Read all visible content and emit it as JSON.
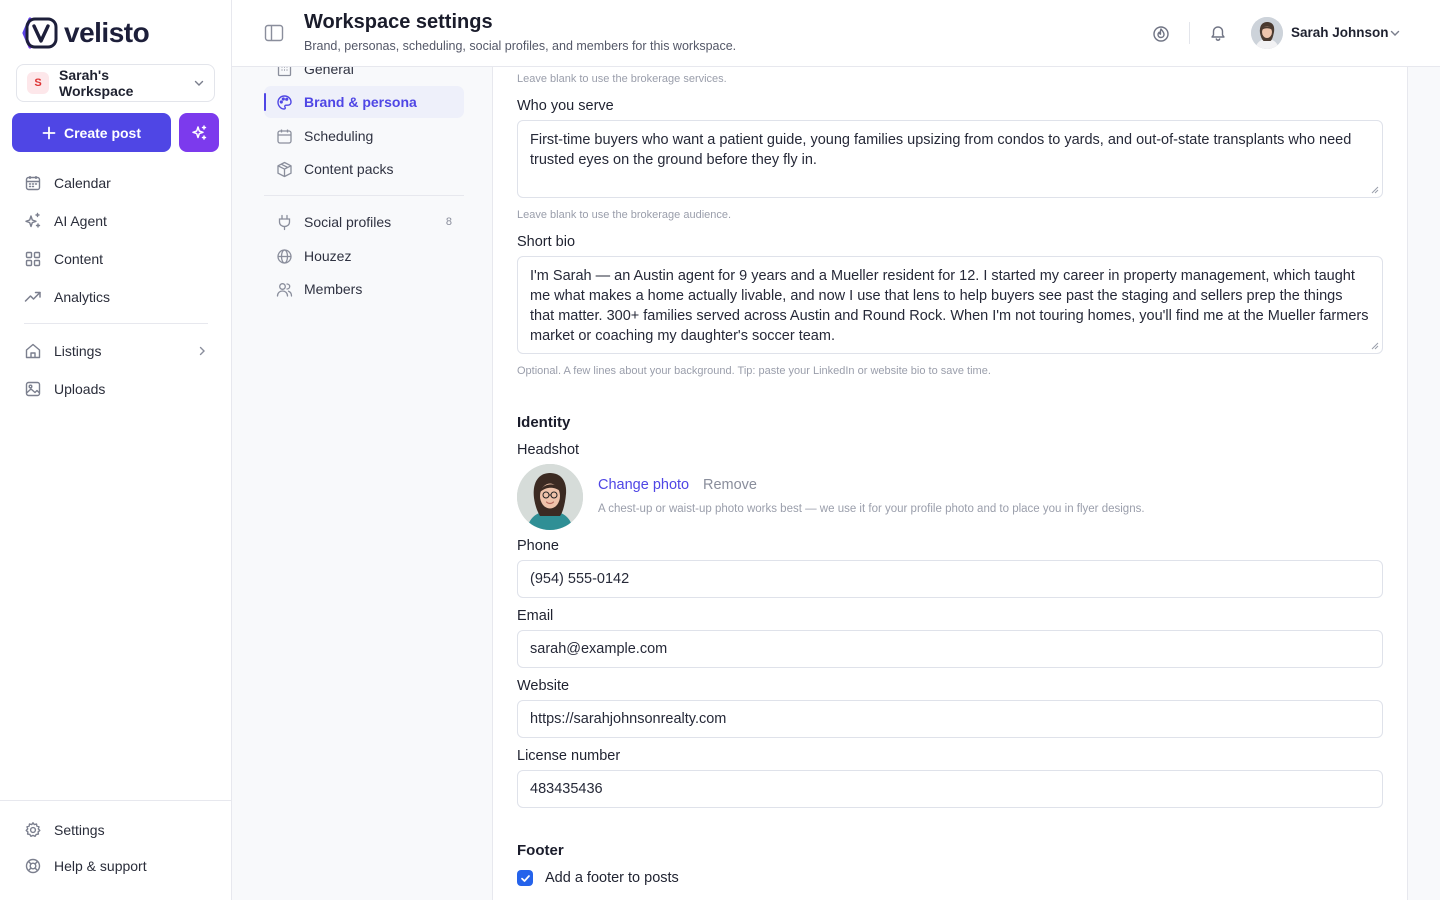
{
  "app": {
    "brand": "velisto",
    "workspace": {
      "initial": "S",
      "name": "Sarah's Workspace"
    },
    "create_label": "Create post",
    "accent_color": "#4f46e5",
    "magic_color": "#7c3aed"
  },
  "sidebar": {
    "items": [
      {
        "label": "Calendar",
        "icon": "calendar-icon"
      },
      {
        "label": "AI Agent",
        "icon": "sparkles-icon"
      },
      {
        "label": "Content",
        "icon": "grid-icon"
      },
      {
        "label": "Analytics",
        "icon": "trending-up-icon"
      },
      {
        "label": "Listings",
        "icon": "home-icon"
      },
      {
        "label": "Uploads",
        "icon": "image-icon"
      }
    ],
    "bottom": [
      {
        "label": "Settings",
        "icon": "gear-icon"
      },
      {
        "label": "Help & support",
        "icon": "lifebuoy-icon"
      }
    ]
  },
  "header": {
    "title": "Workspace settings",
    "subtitle": "Brand, personas, scheduling, social profiles, and members for this workspace.",
    "user_name": "Sarah Johnson"
  },
  "subnav": {
    "items": [
      {
        "label": "General",
        "icon": "building-icon"
      },
      {
        "label": "Brand & persona",
        "icon": "palette-icon",
        "active": true
      },
      {
        "label": "Scheduling",
        "icon": "calendar-icon"
      },
      {
        "label": "Content packs",
        "icon": "package-icon"
      },
      {
        "label": "Social profiles",
        "icon": "plug-icon",
        "count": "8"
      },
      {
        "label": "Houzez",
        "icon": "globe-icon"
      },
      {
        "label": "Members",
        "icon": "users-icon"
      }
    ]
  },
  "form": {
    "services_hint": "Leave blank to use the brokerage services.",
    "who_you_serve": {
      "label": "Who you serve",
      "value": "First-time buyers who want a patient guide, young families upsizing from condos to yards, and out-of-state  transplants who need trusted eyes on the ground before they fly in.",
      "hint": "Leave blank to use the brokerage audience."
    },
    "short_bio": {
      "label": "Short bio",
      "value": "I'm Sarah — an Austin agent for 9 years and a Mueller resident for 12. I started my career in property management,  which taught me what makes a home actually livable, and now I use that lens to help buyers see past the staging and sellers prep the things that matter. 300+ families served across Austin and Round Rock. When I'm not touring homes, you'll find me at the Mueller farmers market or coaching my daughter's soccer team.",
      "hint": "Optional. A few lines about your background. Tip: paste your LinkedIn or website bio to save time."
    },
    "identity": {
      "title": "Identity",
      "headshot_label": "Headshot",
      "change_photo": "Change photo",
      "remove": "Remove",
      "headshot_hint": "A chest-up or waist-up photo works best — we use it for your profile photo and to place you in flyer designs."
    },
    "phone": {
      "label": "Phone",
      "value": "(954) 555-0142"
    },
    "email": {
      "label": "Email",
      "value": "sarah@example.com"
    },
    "website": {
      "label": "Website",
      "value": "https://sarahjohnsonrealty.com"
    },
    "license": {
      "label": "License number",
      "value": "483435436"
    },
    "footer": {
      "title": "Footer",
      "checkbox_label": "Add a footer to posts",
      "checked": true
    }
  }
}
